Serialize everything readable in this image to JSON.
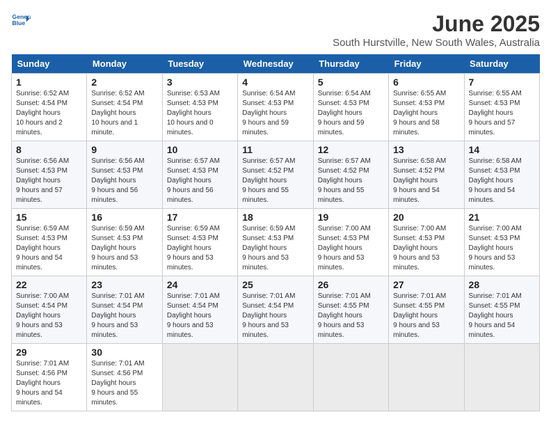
{
  "logo": {
    "line1": "General",
    "line2": "Blue"
  },
  "title": "June 2025",
  "subtitle": "South Hurstville, New South Wales, Australia",
  "days_of_week": [
    "Sunday",
    "Monday",
    "Tuesday",
    "Wednesday",
    "Thursday",
    "Friday",
    "Saturday"
  ],
  "weeks": [
    [
      {
        "num": "1",
        "rise": "6:52 AM",
        "set": "4:54 PM",
        "hours": "10 hours and 2 minutes."
      },
      {
        "num": "2",
        "rise": "6:52 AM",
        "set": "4:54 PM",
        "hours": "10 hours and 1 minute."
      },
      {
        "num": "3",
        "rise": "6:53 AM",
        "set": "4:53 PM",
        "hours": "10 hours and 0 minutes."
      },
      {
        "num": "4",
        "rise": "6:54 AM",
        "set": "4:53 PM",
        "hours": "9 hours and 59 minutes."
      },
      {
        "num": "5",
        "rise": "6:54 AM",
        "set": "4:53 PM",
        "hours": "9 hours and 59 minutes."
      },
      {
        "num": "6",
        "rise": "6:55 AM",
        "set": "4:53 PM",
        "hours": "9 hours and 58 minutes."
      },
      {
        "num": "7",
        "rise": "6:55 AM",
        "set": "4:53 PM",
        "hours": "9 hours and 57 minutes."
      }
    ],
    [
      {
        "num": "8",
        "rise": "6:56 AM",
        "set": "4:53 PM",
        "hours": "9 hours and 57 minutes."
      },
      {
        "num": "9",
        "rise": "6:56 AM",
        "set": "4:53 PM",
        "hours": "9 hours and 56 minutes."
      },
      {
        "num": "10",
        "rise": "6:57 AM",
        "set": "4:53 PM",
        "hours": "9 hours and 56 minutes."
      },
      {
        "num": "11",
        "rise": "6:57 AM",
        "set": "4:52 PM",
        "hours": "9 hours and 55 minutes."
      },
      {
        "num": "12",
        "rise": "6:57 AM",
        "set": "4:52 PM",
        "hours": "9 hours and 55 minutes."
      },
      {
        "num": "13",
        "rise": "6:58 AM",
        "set": "4:52 PM",
        "hours": "9 hours and 54 minutes."
      },
      {
        "num": "14",
        "rise": "6:58 AM",
        "set": "4:53 PM",
        "hours": "9 hours and 54 minutes."
      }
    ],
    [
      {
        "num": "15",
        "rise": "6:59 AM",
        "set": "4:53 PM",
        "hours": "9 hours and 54 minutes."
      },
      {
        "num": "16",
        "rise": "6:59 AM",
        "set": "4:53 PM",
        "hours": "9 hours and 53 minutes."
      },
      {
        "num": "17",
        "rise": "6:59 AM",
        "set": "4:53 PM",
        "hours": "9 hours and 53 minutes."
      },
      {
        "num": "18",
        "rise": "6:59 AM",
        "set": "4:53 PM",
        "hours": "9 hours and 53 minutes."
      },
      {
        "num": "19",
        "rise": "7:00 AM",
        "set": "4:53 PM",
        "hours": "9 hours and 53 minutes."
      },
      {
        "num": "20",
        "rise": "7:00 AM",
        "set": "4:53 PM",
        "hours": "9 hours and 53 minutes."
      },
      {
        "num": "21",
        "rise": "7:00 AM",
        "set": "4:53 PM",
        "hours": "9 hours and 53 minutes."
      }
    ],
    [
      {
        "num": "22",
        "rise": "7:00 AM",
        "set": "4:54 PM",
        "hours": "9 hours and 53 minutes."
      },
      {
        "num": "23",
        "rise": "7:01 AM",
        "set": "4:54 PM",
        "hours": "9 hours and 53 minutes."
      },
      {
        "num": "24",
        "rise": "7:01 AM",
        "set": "4:54 PM",
        "hours": "9 hours and 53 minutes."
      },
      {
        "num": "25",
        "rise": "7:01 AM",
        "set": "4:54 PM",
        "hours": "9 hours and 53 minutes."
      },
      {
        "num": "26",
        "rise": "7:01 AM",
        "set": "4:55 PM",
        "hours": "9 hours and 53 minutes."
      },
      {
        "num": "27",
        "rise": "7:01 AM",
        "set": "4:55 PM",
        "hours": "9 hours and 53 minutes."
      },
      {
        "num": "28",
        "rise": "7:01 AM",
        "set": "4:55 PM",
        "hours": "9 hours and 54 minutes."
      }
    ],
    [
      {
        "num": "29",
        "rise": "7:01 AM",
        "set": "4:56 PM",
        "hours": "9 hours and 54 minutes."
      },
      {
        "num": "30",
        "rise": "7:01 AM",
        "set": "4:56 PM",
        "hours": "9 hours and 55 minutes."
      },
      null,
      null,
      null,
      null,
      null
    ]
  ]
}
